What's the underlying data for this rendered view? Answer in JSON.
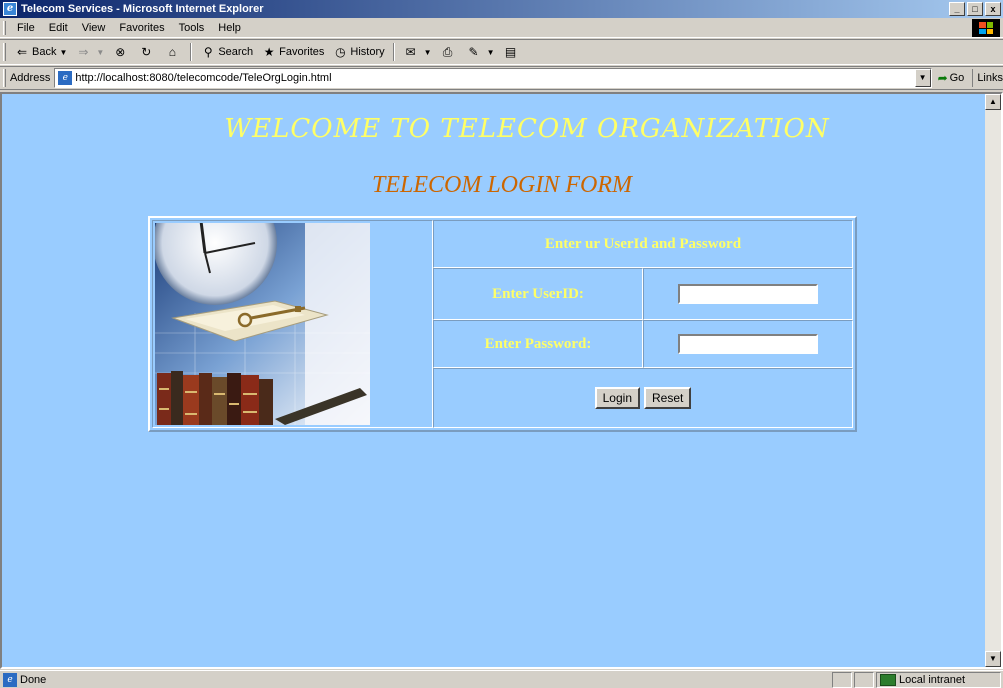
{
  "window": {
    "title": "Telecom Services - Microsoft Internet Explorer",
    "buttons": {
      "minimize": "_",
      "maximize": "□",
      "close": "x"
    }
  },
  "menubar": {
    "items": [
      {
        "label": "File"
      },
      {
        "label": "Edit"
      },
      {
        "label": "View"
      },
      {
        "label": "Favorites"
      },
      {
        "label": "Tools"
      },
      {
        "label": "Help"
      }
    ]
  },
  "toolbar": {
    "back": "Back",
    "search": "Search",
    "favorites": "Favorites",
    "history": "History",
    "icons": [
      "back-arrow-icon",
      "forward-arrow-icon",
      "stop-icon",
      "refresh-icon",
      "home-icon",
      "search-icon",
      "favorites-icon",
      "history-icon",
      "mail-icon",
      "print-icon",
      "edit-icon",
      "discuss-icon"
    ]
  },
  "addressbar": {
    "label": "Address",
    "url": "http://localhost:8080/telecomcode/TeleOrgLogin.html",
    "go": "Go",
    "links": "Links"
  },
  "page": {
    "welcome": "WELCOME TO TELECOM ORGANIZATION",
    "form_title": "TELECOM LOGIN FORM",
    "instruction": "Enter ur UserId and Password",
    "userid_label": "Enter UserID:",
    "password_label": "Enter Password:",
    "userid_value": "",
    "password_value": "",
    "login_button": "Login",
    "reset_button": "Reset",
    "colors": {
      "background": "#99ccff",
      "heading": "#ffff66",
      "form_title": "#cc6600"
    }
  },
  "statusbar": {
    "status": "Done",
    "zone": "Local intranet"
  }
}
